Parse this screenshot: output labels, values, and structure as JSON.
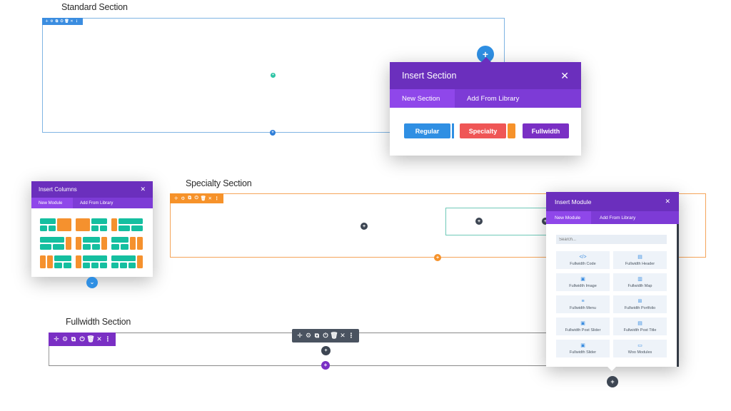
{
  "sections": {
    "standard": {
      "title": "Standard Section",
      "color": "#3b8de0"
    },
    "specialty": {
      "title": "Specialty Section",
      "color": "#f6922a"
    },
    "fullwidth": {
      "title": "Fullwidth Section",
      "color": "#7a2fc4"
    }
  },
  "toolbar_icons": [
    "move-icon",
    "gear-icon",
    "duplicate-icon",
    "power-icon",
    "trash-icon",
    "close-icon",
    "more-icon"
  ],
  "toolbar_glyphs": [
    "✛",
    "⚙",
    "⧉",
    "⏻",
    "🗑",
    "✕",
    "⋮"
  ],
  "add_glyph": "+",
  "chevron_glyph": "⌄",
  "insert_section": {
    "title": "Insert Section",
    "close": "✕",
    "tabs": [
      "New Section",
      "Add From Library"
    ],
    "active_tab": 0,
    "buttons": [
      {
        "label": "Regular",
        "color": "#2f8fe3"
      },
      {
        "label": "Specialty",
        "color": "#ef5656"
      },
      {
        "label": "Fullwidth",
        "color": "#7a2fc4"
      }
    ]
  },
  "insert_columns": {
    "title": "Insert Columns",
    "close": "✕",
    "tabs": [
      "New Module",
      "Add From Library"
    ],
    "active_tab": 0,
    "layout_count": 9
  },
  "insert_module": {
    "title": "Insert Module",
    "close": "✕",
    "tabs": [
      "New Module",
      "Add From Library"
    ],
    "active_tab": 0,
    "search_placeholder": "Search...",
    "modules": [
      {
        "label": "Fullwidth Code",
        "icon": "code-icon",
        "glyph": "</>"
      },
      {
        "label": "Fullwidth Header",
        "icon": "header-icon",
        "glyph": "▤"
      },
      {
        "label": "Fullwidth Image",
        "icon": "image-icon",
        "glyph": "▣"
      },
      {
        "label": "Fullwidth Map",
        "icon": "map-icon",
        "glyph": "▥"
      },
      {
        "label": "Fullwidth Menu",
        "icon": "menu-icon",
        "glyph": "≡"
      },
      {
        "label": "Fullwidth Portfolio",
        "icon": "portfolio-icon",
        "glyph": "⊞"
      },
      {
        "label": "Fullwidth Post Slider",
        "icon": "post-slider-icon",
        "glyph": "▣"
      },
      {
        "label": "Fullwidth Post Title",
        "icon": "post-title-icon",
        "glyph": "▤"
      },
      {
        "label": "Fullwidth Slider",
        "icon": "slider-icon",
        "glyph": "▣"
      },
      {
        "label": "Woo Modules",
        "icon": "woo-icon",
        "glyph": "▭"
      }
    ]
  }
}
